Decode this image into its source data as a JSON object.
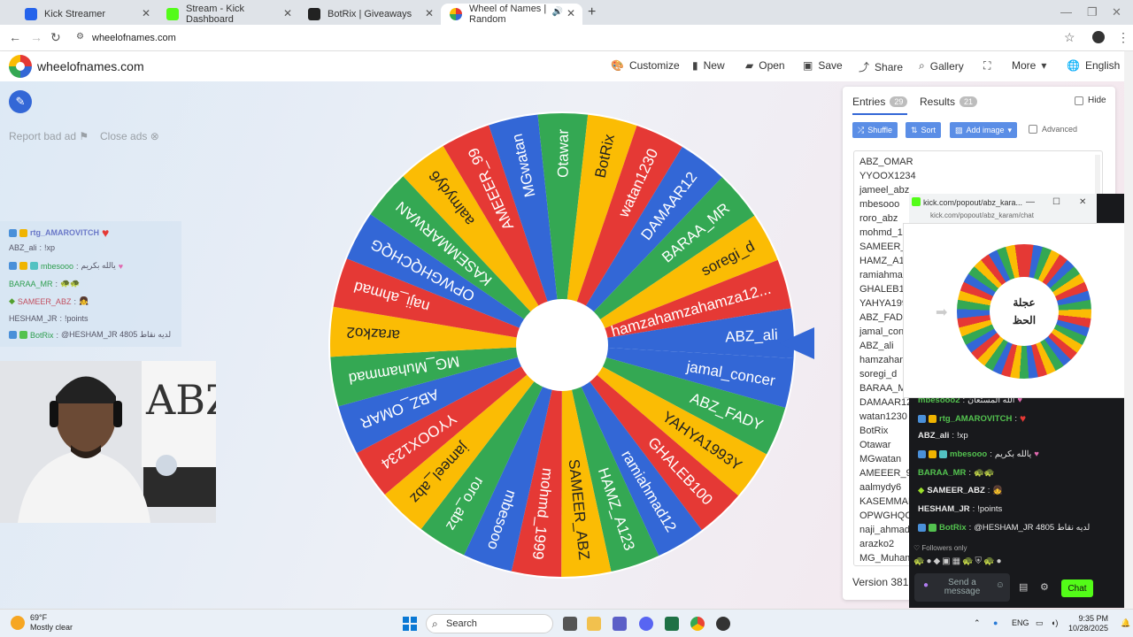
{
  "browser": {
    "tabs": [
      {
        "title": "Kick Streamer",
        "favicon_color": "#2563eb"
      },
      {
        "title": "Stream - Kick Dashboard",
        "favicon_color": "#53fc18"
      },
      {
        "title": "BotRix | Giveaways",
        "favicon_color": "#222222"
      },
      {
        "title": "Wheel of Names | Random",
        "favicon_color": "#3367d6"
      }
    ],
    "url": "wheelofnames.com",
    "new_tab_icon": "plus-icon"
  },
  "site": {
    "brand": "wheelofnames.com",
    "menu": [
      "Customize",
      "New",
      "Open",
      "Save",
      "Share",
      "Gallery",
      "More",
      "English"
    ],
    "report_ad": "Report bad ad",
    "close_ads": "Close ads"
  },
  "wheel": {
    "colors": [
      "#3367d6",
      "#34a853",
      "#fbbc04",
      "#e53935"
    ],
    "selected": "jamal_concer",
    "segments": [
      "jamal_concer",
      "ABZ_FADY",
      "YAHYA1993Y",
      "GHALEB100",
      "ramiahmad12",
      "HAMZ_A123",
      "SAMEER_ABZ",
      "mohmd_1999",
      "mbesooo",
      "roro_abz",
      "jameel_abz",
      "YYOOX1234",
      "ABZ_OMAR",
      "MG_Muhammad",
      "arazko2",
      "naji_ahmad",
      "OPWGHQCHQG",
      "KASEMMARWAN",
      "aalmydy6",
      "AMEEER_99",
      "MGwatan",
      "Otawar",
      "BotRix",
      "watan1230",
      "DAMAAR12",
      "BARAA_MR",
      "soregi_d",
      "hamzahamzahamza12...",
      "ABZ_ali"
    ]
  },
  "panel": {
    "tab_entries": "Entries",
    "entries_count": "29",
    "tab_results": "Results",
    "results_count": "21",
    "hide": "Hide",
    "shuffle": "Shuffle",
    "sort": "Sort",
    "add_image": "Add image",
    "advanced": "Advanced",
    "entries": [
      "ABZ_OMAR",
      "YYOOX1234",
      "jameel_abz",
      "mbesooo",
      "roro_abz",
      "mohmd_1",
      "SAMEER_A",
      "HAMZ_A1",
      "ramiahma",
      "GHALEB10",
      "YAHYA199",
      "ABZ_FADY",
      "jamal_con",
      "ABZ_ali",
      "hamzahan",
      "soregi_d",
      "BARAA_M",
      "DAMAAR12",
      "watan1230",
      "BotRix",
      "Otawar",
      "MGwatan",
      "AMEEER_99",
      "aalmydy6",
      "KASEMMAR",
      "OPWGHQCH",
      "naji_ahmad",
      "arazko2",
      "MG_Muham"
    ],
    "version": "Version 381"
  },
  "overlay_chat": {
    "lines": [
      {
        "user": "rtg_AMAROVITCH",
        "msg": ""
      },
      {
        "user": "ABZ_ali",
        "msg": "!xp"
      },
      {
        "user": "mbesooo",
        "msg": "يالله بكريم"
      },
      {
        "user": "BARAA_MR",
        "msg": ""
      },
      {
        "user": "SAMEER_ABZ",
        "msg": ""
      },
      {
        "user": "HESHAM_JR",
        "msg": "!points"
      },
      {
        "user": "BotRix",
        "msg": "@HESHAM_JR 4805 لديه نقاط"
      }
    ]
  },
  "webcam": {
    "sign_text": "ABZ"
  },
  "kick_popup": {
    "title": "kick.com/popout/abz_kara...",
    "url": "kick.com/popout/abz_karam/chat",
    "preview_text_1": "عجلة",
    "preview_text_2": "الحظ",
    "chat": [
      {
        "user": "mbesooo2",
        "msg": "الله المستعان"
      },
      {
        "user": "rtg_AMAROVITCH",
        "msg": ""
      },
      {
        "user": "ABZ_ali",
        "msg": "!xp"
      },
      {
        "user": "mbesooo",
        "msg": "يالله بكريم"
      },
      {
        "user": "BARAA_MR",
        "msg": ""
      },
      {
        "user": "SAMEER_ABZ",
        "msg": ""
      },
      {
        "user": "HESHAM_JR",
        "msg": "!points"
      },
      {
        "user": "BotRix",
        "msg": "@HESHAM_JR 4805 لديه نقاط"
      }
    ],
    "followers_only": "Followers only",
    "send_placeholder_1": "Send a",
    "send_placeholder_2": "message",
    "chat_button": "Chat"
  },
  "taskbar": {
    "temperature": "69°F",
    "weather": "Mostly clear",
    "search": "Search",
    "lang": "ENG",
    "time": "9:35 PM",
    "date": "10/28/2025"
  }
}
